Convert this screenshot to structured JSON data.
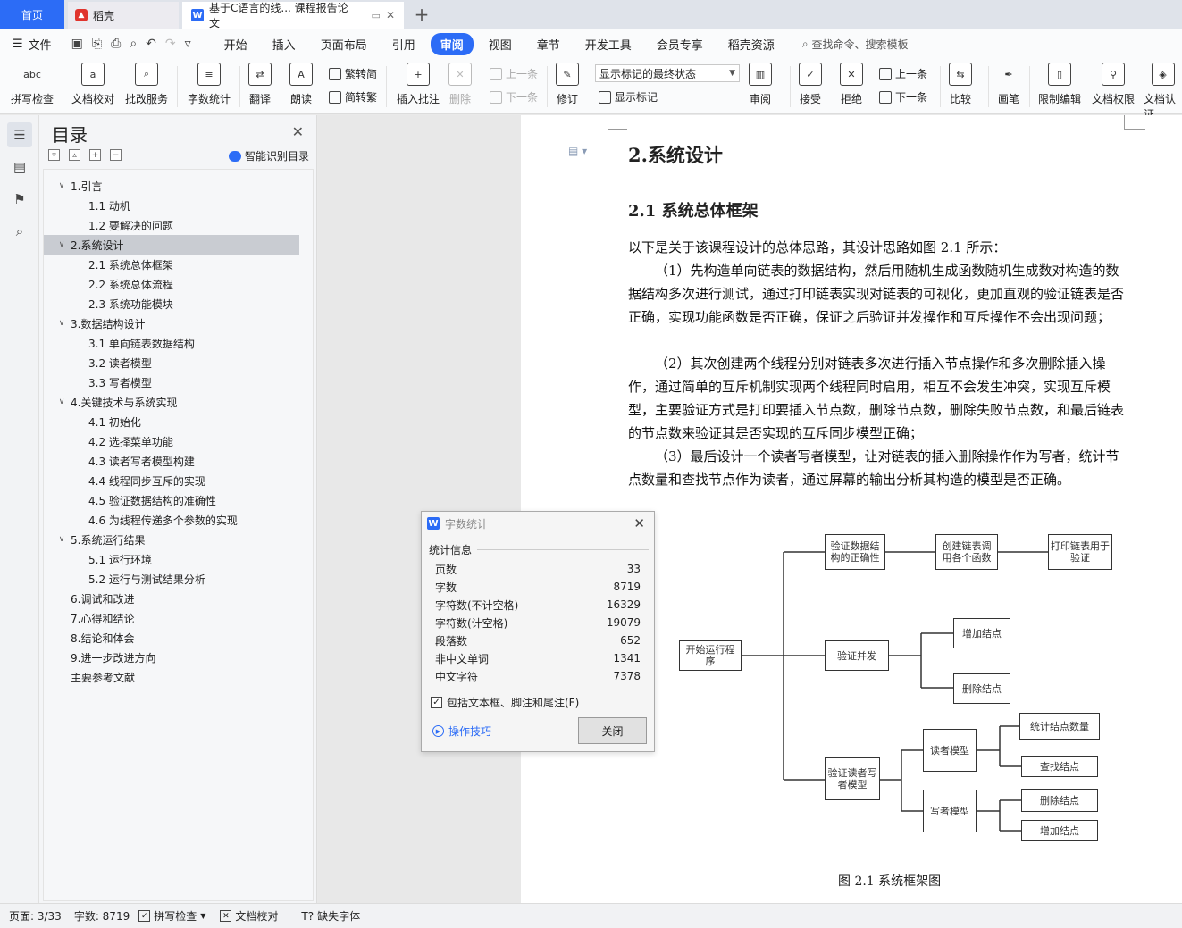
{
  "titlebar": {
    "home_tab": "首页",
    "daoke_tab": "稻壳",
    "doc_tab": "基于C语言的线... 课程报告论文",
    "add_tab": "+"
  },
  "menubar": {
    "file": "文件",
    "tabs": [
      "开始",
      "插入",
      "页面布局",
      "引用",
      "审阅",
      "视图",
      "章节",
      "开发工具",
      "会员专享",
      "稻壳资源"
    ],
    "active_tab": "审阅",
    "search": "查找命令、搜索模板"
  },
  "ribbon": {
    "spellcheck": "拼写检查",
    "proofread": "文档校对",
    "annotate_service": "批改服务",
    "wordcount": "字数统计",
    "translate": "翻译",
    "read_aloud": "朗读",
    "trad_to_simp": "繁转简",
    "simp_to_trad": "简转繁",
    "insert_comment": "插入批注",
    "delete": "删除",
    "prev_comment": "上一条",
    "next_comment": "下一条",
    "revise": "修订",
    "markup_state": "显示标记的最终状态",
    "show_markup": "显示标记",
    "review": "审阅",
    "accept": "接受",
    "reject": "拒绝",
    "prev_change": "上一条",
    "next_change": "下一条",
    "compare": "比较",
    "pen": "画笔",
    "restrict_edit": "限制编辑",
    "doc_permission": "文档权限",
    "doc_cert": "文档认证"
  },
  "toc": {
    "title": "目录",
    "smart_label": "智能识别目录",
    "items": [
      {
        "label": "1.引言",
        "level": 1,
        "expanded": true
      },
      {
        "label": "1.1 动机",
        "level": 2
      },
      {
        "label": "1.2  要解决的问题",
        "level": 2
      },
      {
        "label": "2.系统设计",
        "level": 1,
        "expanded": true,
        "selected": true
      },
      {
        "label": "2.1 系统总体框架",
        "level": 2
      },
      {
        "label": "2.2  系统总体流程",
        "level": 2
      },
      {
        "label": "2.3  系统功能模块",
        "level": 2
      },
      {
        "label": "3.数据结构设计",
        "level": 1,
        "expanded": true
      },
      {
        "label": "3.1 单向链表数据结构",
        "level": 2
      },
      {
        "label": "3.2 读者模型",
        "level": 2
      },
      {
        "label": "3.3 写者模型",
        "level": 2
      },
      {
        "label": "4.关键技术与系统实现",
        "level": 1,
        "expanded": true
      },
      {
        "label": "4.1 初始化",
        "level": 2
      },
      {
        "label": "4.2 选择菜单功能",
        "level": 2
      },
      {
        "label": "4.3 读者写者模型构建",
        "level": 2
      },
      {
        "label": "4.4 线程同步互斥的实现",
        "level": 2
      },
      {
        "label": "4.5 验证数据结构的准确性",
        "level": 2
      },
      {
        "label": "4.6 为线程传递多个参数的实现",
        "level": 2
      },
      {
        "label": "5.系统运行结果",
        "level": 1,
        "expanded": true
      },
      {
        "label": "5.1 运行环境",
        "level": 2
      },
      {
        "label": "5.2 运行与测试结果分析",
        "level": 2
      },
      {
        "label": "6.调试和改进",
        "level": 1
      },
      {
        "label": "7.心得和结论",
        "level": 1
      },
      {
        "label": "8.结论和体会",
        "level": 1
      },
      {
        "label": "9.进一步改进方向",
        "level": 1
      },
      {
        "label": "主要参考文献",
        "level": 1
      }
    ]
  },
  "document": {
    "heading1": "2.系统设计",
    "heading2": "2.1 系统总体框架",
    "paragraphs": [
      "以下是关于该课程设计的总体思路，其设计思路如图 2.1 所示：",
      "（1）先构造单向链表的数据结构，然后用随机生成函数随机生成数对构造的数据结构多次进行测试，通过打印链表实现对链表的可视化，更加直观的验证链表是否正确，实现功能函数是否正确，保证之后验证并发操作和互斥操作不会出现问题；",
      "（2）其次创建两个线程分别对链表多次进行插入节点操作和多次删除插入操作，通过简单的互斥机制实现两个线程同时启用，相互不会发生冲突，实现互斥模型，主要验证方式是打印要插入节点数，删除节点数，删除失败节点数，和最后链表的节点数来验证其是否实现的互斥同步模型正确；",
      "（3）最后设计一个读者写者模型，让对链表的插入删除操作作为写者，统计节点数量和查找节点作为读者，通过屏幕的输出分析其构造的模型是否正确。"
    ],
    "figure": {
      "caption": "图 2.1  系统框架图",
      "nodes": {
        "start": "开始运行程序",
        "verify_ds": "验证数据结构的正确性",
        "create_list": "创建链表调用各个函数",
        "print_list": "打印链表用于验证",
        "verify_concurrency": "验证并发",
        "add_node": "增加结点",
        "delete_node": "删除结点",
        "verify_rw": "验证读者写者模型",
        "reader_model": "读者模型",
        "writer_model": "写者模型",
        "count_nodes": "统计结点数量",
        "find_node": "查找结点",
        "w_delete_node": "删除结点",
        "w_add_node": "增加结点"
      }
    }
  },
  "wordcount_dialog": {
    "title": "字数统计",
    "section": "统计信息",
    "stats": [
      {
        "label": "页数",
        "value": "33"
      },
      {
        "label": "字数",
        "value": "8719"
      },
      {
        "label": "字符数(不计空格)",
        "value": "16329"
      },
      {
        "label": "字符数(计空格)",
        "value": "19079"
      },
      {
        "label": "段落数",
        "value": "652"
      },
      {
        "label": "非中文单词",
        "value": "1341"
      },
      {
        "label": "中文字符",
        "value": "7378"
      }
    ],
    "include_label": "包括文本框、脚注和尾注(F)",
    "include_checked": true,
    "tips": "操作技巧",
    "close_button": "关闭"
  },
  "statusbar": {
    "page": "页面: 3/33",
    "words": "字数: 8719",
    "spellcheck": "拼写检查",
    "proofread": "文档校对",
    "missing_font": "缺失字体"
  },
  "colors": {
    "accent": "#2c6cf6",
    "toc_selected": "#c9ccd2",
    "daoke_red": "#e0342d"
  }
}
